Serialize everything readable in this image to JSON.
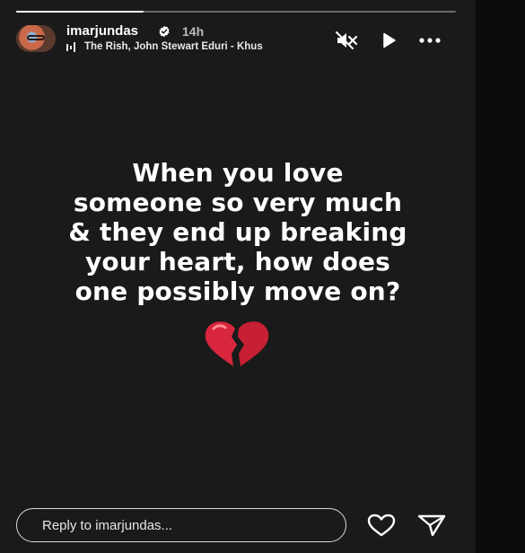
{
  "story": {
    "username": "imarjundas",
    "time_ago": "14h",
    "music": "The Rish, John Stewart Eduri - Khus",
    "progress": 0.29,
    "caption": "When you love\nsomeone so very much\n& they end up breaking\nyour heart, how does\none possibly move on?",
    "emoji": "broken-heart-emoji"
  },
  "controls": {
    "mute_icon": "muted-speaker-icon",
    "play_icon": "play-icon",
    "more_icon": "more-options-icon"
  },
  "footer": {
    "reply_placeholder": "Reply to imarjundas...",
    "like_icon": "heart-icon",
    "share_icon": "send-icon"
  },
  "colors": {
    "background": "#1a1a1a",
    "text": "#ffffff",
    "heart_red": "#d7263d",
    "verified_blue": "#ffffff"
  }
}
